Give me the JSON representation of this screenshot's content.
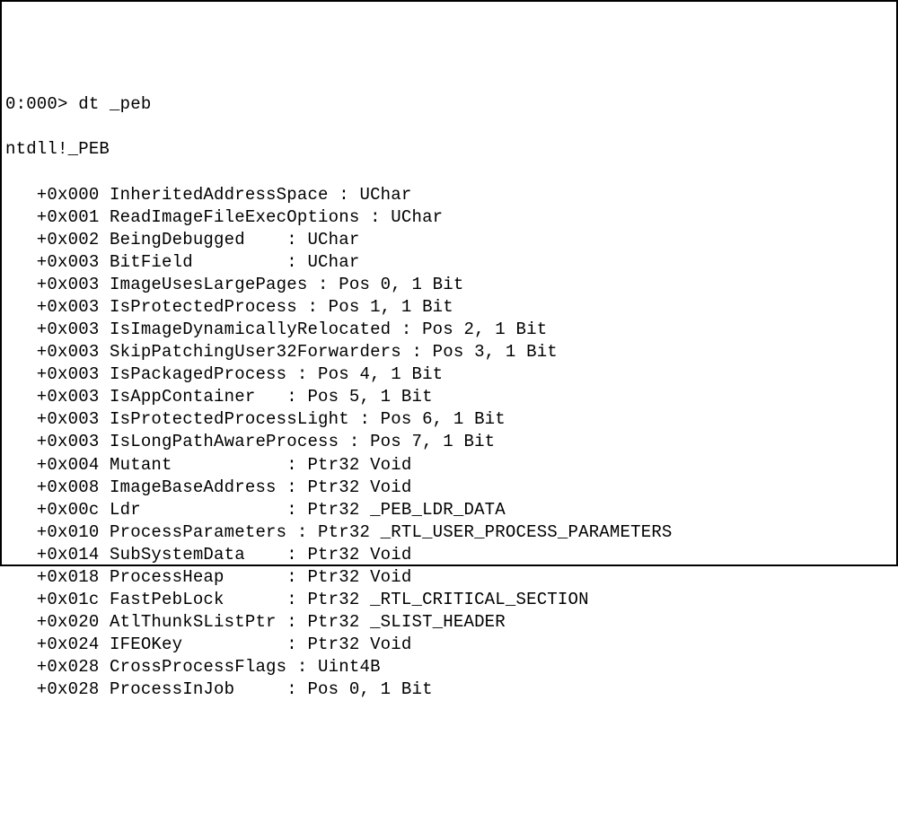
{
  "prompt": "0:000> dt _peb",
  "type_header": "ntdll!_PEB",
  "fields": [
    {
      "offset": "+0x000",
      "name": "InheritedAddressSpace",
      "info": ": UChar"
    },
    {
      "offset": "+0x001",
      "name": "ReadImageFileExecOptions",
      "info": ": UChar"
    },
    {
      "offset": "+0x002",
      "name": "BeingDebugged",
      "pad": "    ",
      "info": ": UChar"
    },
    {
      "offset": "+0x003",
      "name": "BitField",
      "pad": "         ",
      "info": ": UChar"
    },
    {
      "offset": "+0x003",
      "name": "ImageUsesLargePages",
      "info": ": Pos 0, 1 Bit"
    },
    {
      "offset": "+0x003",
      "name": "IsProtectedProcess",
      "info": ": Pos 1, 1 Bit"
    },
    {
      "offset": "+0x003",
      "name": "IsImageDynamicallyRelocated",
      "info": ": Pos 2, 1 Bit"
    },
    {
      "offset": "+0x003",
      "name": "SkipPatchingUser32Forwarders",
      "info": ": Pos 3, 1 Bit"
    },
    {
      "offset": "+0x003",
      "name": "IsPackagedProcess",
      "info": ": Pos 4, 1 Bit"
    },
    {
      "offset": "+0x003",
      "name": "IsAppContainer",
      "pad": "   ",
      "info": ": Pos 5, 1 Bit"
    },
    {
      "offset": "+0x003",
      "name": "IsProtectedProcessLight",
      "info": ": Pos 6, 1 Bit"
    },
    {
      "offset": "+0x003",
      "name": "IsLongPathAwareProcess",
      "info": ": Pos 7, 1 Bit"
    },
    {
      "offset": "+0x004",
      "name": "Mutant",
      "pad": "           ",
      "info": ": Ptr32 Void"
    },
    {
      "offset": "+0x008",
      "name": "ImageBaseAddress",
      "pad": " ",
      "info": ": Ptr32 Void"
    },
    {
      "offset": "+0x00c",
      "name": "Ldr",
      "pad": "              ",
      "info": ": Ptr32 _PEB_LDR_DATA"
    },
    {
      "offset": "+0x010",
      "name": "ProcessParameters",
      "info": ": Ptr32 _RTL_USER_PROCESS_PARAMETERS"
    },
    {
      "offset": "+0x014",
      "name": "SubSystemData",
      "pad": "    ",
      "info": ": Ptr32 Void"
    },
    {
      "offset": "+0x018",
      "name": "ProcessHeap",
      "pad": "      ",
      "info": ": Ptr32 Void"
    },
    {
      "offset": "+0x01c",
      "name": "FastPebLock",
      "pad": "      ",
      "info": ": Ptr32 _RTL_CRITICAL_SECTION"
    },
    {
      "offset": "+0x020",
      "name": "AtlThunkSListPtr",
      "pad": " ",
      "info": ": Ptr32 _SLIST_HEADER"
    },
    {
      "offset": "+0x024",
      "name": "IFEOKey",
      "pad": "          ",
      "info": ": Ptr32 Void"
    },
    {
      "offset": "+0x028",
      "name": "CrossProcessFlags",
      "info": ": Uint4B"
    },
    {
      "offset": "+0x028",
      "name": "ProcessInJob",
      "pad": "     ",
      "info": ": Pos 0, 1 Bit"
    }
  ]
}
